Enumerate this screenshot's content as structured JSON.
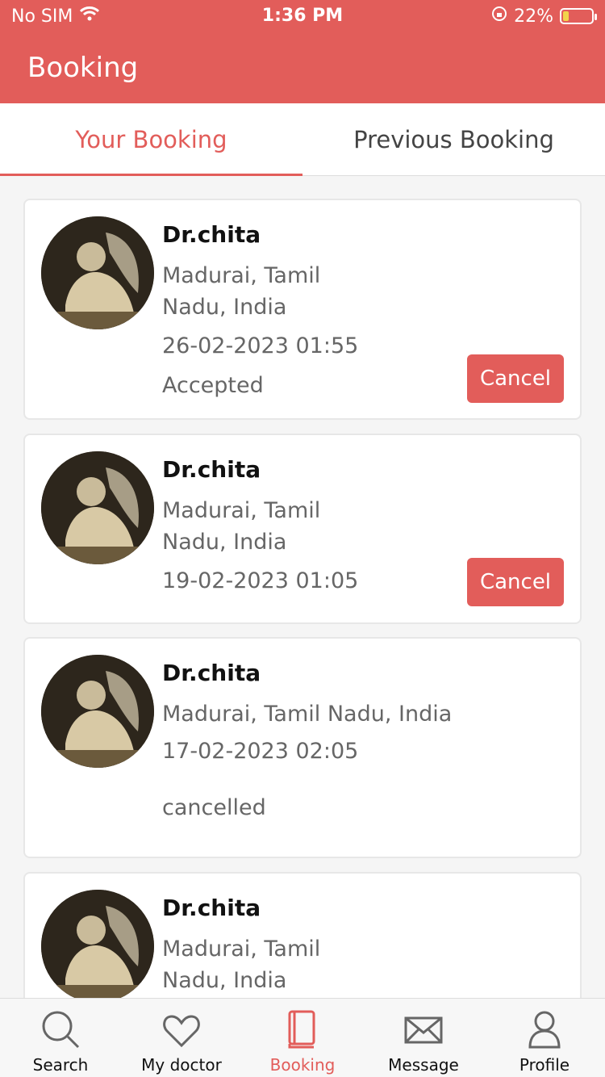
{
  "status_bar": {
    "carrier": "No SIM",
    "time": "1:36 PM",
    "battery": "22%"
  },
  "header": {
    "title": "Booking"
  },
  "tabs": [
    {
      "label": "Your Booking",
      "active": true
    },
    {
      "label": "Previous Booking",
      "active": false
    }
  ],
  "bookings": [
    {
      "name": "Dr.chita",
      "address_line1": "Madurai, Tamil",
      "address_line2": "Nadu, India",
      "datetime": "26-02-2023 01:55",
      "status": "Accepted",
      "cancel_label": "Cancel"
    },
    {
      "name": "Dr.chita",
      "address_line1": "Madurai, Tamil",
      "address_line2": "Nadu, India",
      "datetime": "19-02-2023 01:05",
      "cancel_label": "Cancel"
    },
    {
      "name": "Dr.chita",
      "address": "Madurai, Tamil Nadu, India",
      "datetime": "17-02-2023 02:05",
      "status": "cancelled"
    },
    {
      "name": "Dr.chita",
      "address_line1": "Madurai, Tamil",
      "address_line2": "Nadu, India"
    }
  ],
  "bottom_nav": [
    {
      "label": "Search",
      "icon": "search-icon"
    },
    {
      "label": "My doctor",
      "icon": "heart-icon"
    },
    {
      "label": "Booking",
      "icon": "book-icon",
      "active": true
    },
    {
      "label": "Message",
      "icon": "envelope-icon"
    },
    {
      "label": "Profile",
      "icon": "user-icon"
    }
  ],
  "colors": {
    "accent": "#e25d5a",
    "text_muted": "#666666"
  }
}
